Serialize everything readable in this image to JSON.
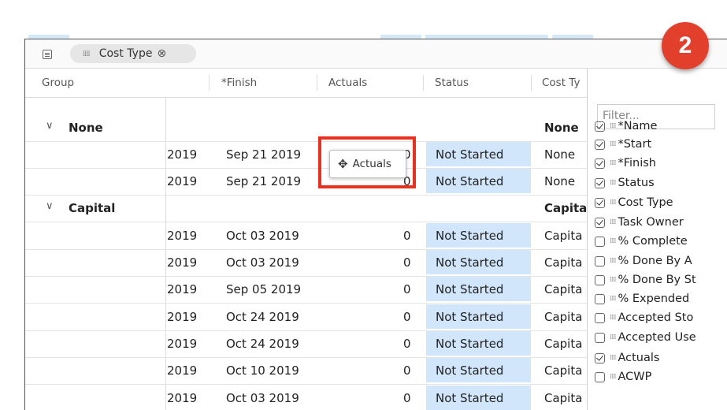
{
  "toolbar": {
    "chip_label": "Cost Type",
    "chip_close": "⊗"
  },
  "columns": {
    "group": "Group",
    "finish": "*Finish",
    "actuals": "Actuals",
    "status": "Status",
    "cost_type": "Cost Ty"
  },
  "groups": [
    {
      "label": "None",
      "cost_type": "None"
    },
    {
      "label": "Capital",
      "cost_type": "Capita"
    }
  ],
  "rows": [
    {
      "start": "2019",
      "finish": "Sep 21 2019",
      "actuals": "0",
      "status": "Not Started",
      "cost_type": "None"
    },
    {
      "start": "2019",
      "finish": "Sep 21 2019",
      "actuals": "0",
      "status": "Not Started",
      "cost_type": "None"
    },
    {
      "start": "2019",
      "finish": "Oct 03 2019",
      "actuals": "0",
      "status": "Not Started",
      "cost_type": "Capita"
    },
    {
      "start": "2019",
      "finish": "Oct 03 2019",
      "actuals": "0",
      "status": "Not Started",
      "cost_type": "Capita"
    },
    {
      "start": "2019",
      "finish": "Sep 05 2019",
      "actuals": "0",
      "status": "Not Started",
      "cost_type": "Capita"
    },
    {
      "start": "2019",
      "finish": "Oct 24 2019",
      "actuals": "0",
      "status": "Not Started",
      "cost_type": "Capita"
    },
    {
      "start": "2019",
      "finish": "Oct 24 2019",
      "actuals": "0",
      "status": "Not Started",
      "cost_type": "Capita"
    },
    {
      "start": "2019",
      "finish": "Oct 10 2019",
      "actuals": "0",
      "status": "Not Started",
      "cost_type": "Capita"
    },
    {
      "start": "2019",
      "finish": "Oct 03 2019",
      "actuals": "0",
      "status": "Not Started",
      "cost_type": "Capita"
    }
  ],
  "panel": {
    "filter_placeholder": "Filter...",
    "items": [
      {
        "label": "*Name",
        "checked": true
      },
      {
        "label": "*Start",
        "checked": true
      },
      {
        "label": "*Finish",
        "checked": true
      },
      {
        "label": "Status",
        "checked": true
      },
      {
        "label": "Cost Type",
        "checked": true
      },
      {
        "label": "Task Owner",
        "checked": true
      },
      {
        "label": "% Complete",
        "checked": false
      },
      {
        "label": "% Done By A",
        "checked": false
      },
      {
        "label": "% Done By St",
        "checked": false
      },
      {
        "label": "% Expended",
        "checked": false
      },
      {
        "label": "Accepted Sto",
        "checked": false
      },
      {
        "label": "Accepted Use",
        "checked": false
      },
      {
        "label": "Actuals",
        "checked": true
      },
      {
        "label": "ACWP",
        "checked": false
      }
    ]
  },
  "drag_chip": {
    "label": "Actuals"
  },
  "badge": {
    "number": "2"
  },
  "colors": {
    "status_fill": "#d2e6fb",
    "highlight": "#e8321f",
    "badge": "#e2402c"
  }
}
